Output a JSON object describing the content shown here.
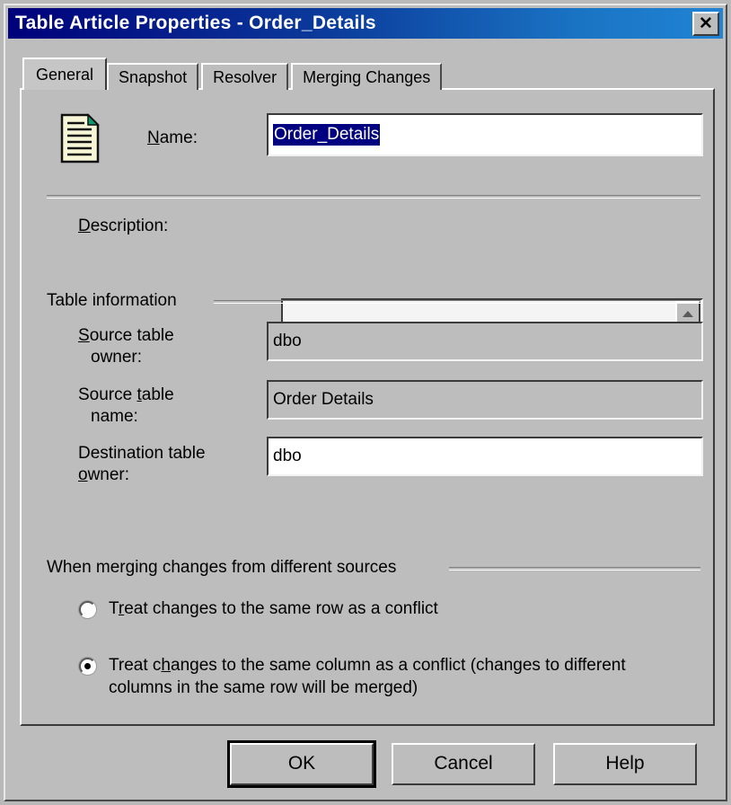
{
  "window": {
    "title": "Table Article Properties - Order_Details",
    "close_label": "✕"
  },
  "tabs": [
    {
      "label": "General",
      "active": true
    },
    {
      "label": "Snapshot",
      "active": false
    },
    {
      "label": "Resolver",
      "active": false
    },
    {
      "label": "Merging Changes",
      "active": false
    }
  ],
  "general": {
    "name": {
      "label_prefix": "",
      "label_accesskey": "N",
      "label_suffix": "ame:",
      "value": "Order_Details",
      "selected": true
    },
    "description": {
      "label_accesskey": "D",
      "label_suffix": "escription:",
      "value": "",
      "placeholder": ""
    },
    "table_information": {
      "group_title": "Table information",
      "fields": [
        {
          "label_line1_pre": "",
          "label_accesskey": "S",
          "label_line1_post": "ource table",
          "label_line2": "owner:",
          "value": "dbo",
          "readonly": true
        },
        {
          "label_line1_pre": "Source ",
          "label_accesskey": "t",
          "label_line1_post": "able",
          "label_line2": "name:",
          "value": "Order Details",
          "readonly": true
        },
        {
          "label_line1_pre": "Destination table",
          "label_accesskey": "o",
          "label_line1_post": "",
          "label_line2_post": "wner:",
          "value": "dbo",
          "readonly": false
        }
      ]
    },
    "merge_group": {
      "group_title": "When merging changes from different sources",
      "options": [
        {
          "pre": "T",
          "accesskey": "r",
          "post": "eat changes to the same row as a conflict",
          "line2": "",
          "selected": false
        },
        {
          "pre": "Treat c",
          "accesskey": "h",
          "post": "anges to the same column as a conflict (changes to different",
          "line2": "columns in the same row will be merged)",
          "selected": true
        }
      ]
    }
  },
  "buttons": [
    {
      "label": "OK",
      "default": true
    },
    {
      "label": "Cancel",
      "default": false
    },
    {
      "label": "Help",
      "default": false
    }
  ],
  "colors": {
    "face": "#bdbdbd",
    "title_start": "#00007a",
    "title_end": "#2183d4",
    "selection": "#000080",
    "text": "#000000"
  },
  "icons": {
    "name_icon": "document-article-icon",
    "close_icon": "close-icon",
    "scroll_up_icon": "scroll-up-arrow-icon",
    "scroll_down_icon": "scroll-down-arrow-icon"
  }
}
